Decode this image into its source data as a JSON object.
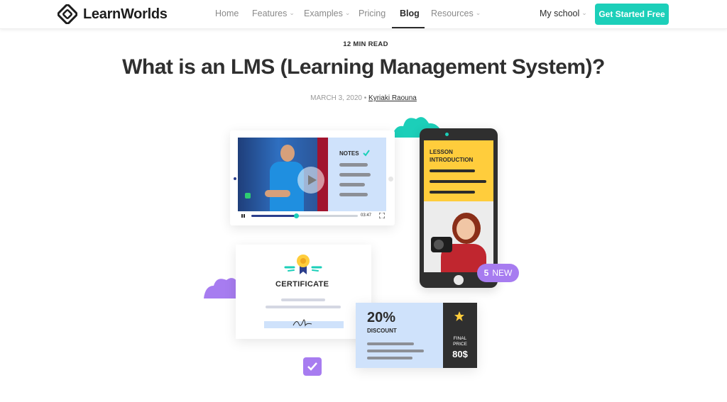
{
  "header": {
    "brand": "LearnWorlds",
    "nav": [
      {
        "label": "Home",
        "has_dropdown": false,
        "active": false
      },
      {
        "label": "Features",
        "has_dropdown": true,
        "active": false
      },
      {
        "label": "Examples",
        "has_dropdown": true,
        "active": false
      },
      {
        "label": "Pricing",
        "has_dropdown": false,
        "active": false
      },
      {
        "label": "Blog",
        "has_dropdown": false,
        "active": true
      },
      {
        "label": "Resources",
        "has_dropdown": true,
        "active": false
      }
    ],
    "my_school": "My school",
    "cta": "Get Started Free"
  },
  "article": {
    "read_time": "12 MIN READ",
    "title": "What is an LMS (Learning Management System)?",
    "date": "MARCH 3, 2020",
    "author": "Kyriaki Raouna"
  },
  "illustration": {
    "notes_label": "NOTES",
    "video_time": "03:47",
    "video_progress": 0.42,
    "lesson_label_line1": "LESSON",
    "lesson_label_line2": "INTRODUCTION",
    "new_badge_count": "5",
    "new_badge_text": "NEW",
    "certificate_label": "CERTIFICATE",
    "discount_value": "20%",
    "discount_label": "DISCOUNT",
    "final_label_line1": "FINAL",
    "final_label_line2": "PRICE",
    "final_price": "80$"
  },
  "colors": {
    "accent": "#1ccfb9",
    "yellow": "#ffcd3c",
    "purple": "#a77cf0",
    "light_blue": "#cfe2fb",
    "dark": "#2b2b2b"
  }
}
